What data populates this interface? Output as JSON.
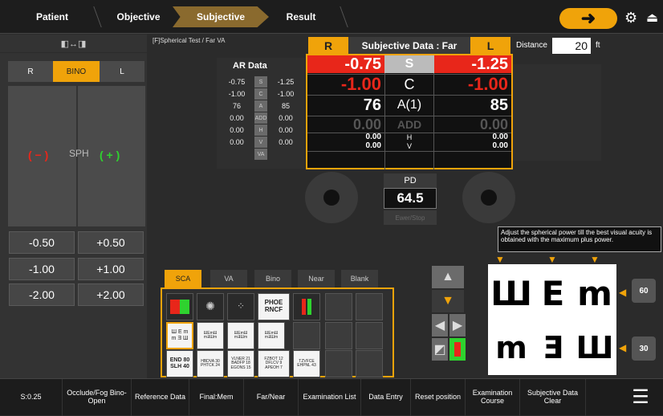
{
  "nav": {
    "steps": [
      "Patient",
      "Objective",
      "Subjective",
      "Result"
    ],
    "active_step": "Subjective"
  },
  "header": {
    "test_name": "[F]Spherical Test / Far VA",
    "r_label": "R",
    "title": "Subjective Data : Far",
    "l_label": "L",
    "distance_label": "Distance",
    "distance_value": "20",
    "distance_unit": "ft"
  },
  "left_panel": {
    "eye_buttons": [
      "R",
      "BINO",
      "L"
    ],
    "active_eye": "BINO",
    "minus_label": "( − )",
    "sph_label": "SPH",
    "plus_label": "( + )",
    "step_buttons": [
      "-0.50",
      "+0.50",
      "-1.00",
      "+1.00",
      "-2.00",
      "+2.00"
    ]
  },
  "ar_data": {
    "title": "AR Data",
    "rows": [
      {
        "r": "-0.75",
        "tag": "S",
        "l": "-1.25"
      },
      {
        "r": "-1.00",
        "tag": "C",
        "l": "-1.00"
      },
      {
        "r": "76",
        "tag": "A",
        "l": "85"
      },
      {
        "r": "0.00",
        "tag": "ADD",
        "l": "0.00"
      },
      {
        "r": "0.00",
        "tag": "H",
        "l": "0.00"
      },
      {
        "r": "0.00",
        "tag": "V",
        "l": "0.00"
      },
      {
        "r": "",
        "tag": "VA",
        "l": ""
      }
    ],
    "right_tags": [
      "S",
      "C",
      "A",
      "ADD",
      "H",
      "V",
      "VA"
    ]
  },
  "subjective": {
    "s_r": "-0.75",
    "s_label": "S",
    "s_l": "-1.25",
    "c_r": "-1.00",
    "c_label": "C",
    "c_l": "-1.00",
    "a_r": "76",
    "a_label": "A(1)",
    "a_l": "85",
    "add_r": "0.00",
    "add_label": "ADD",
    "add_l": "0.00",
    "h_r": "0.00",
    "h_label": "H",
    "h_l": "0.00",
    "v_r": "0.00",
    "v_label": "V",
    "v_l": "0.00"
  },
  "pd": {
    "label": "PD",
    "value": "64.5",
    "small_button": "Ewer/Stop"
  },
  "chart_tabs": [
    "SCA",
    "VA",
    "Bino",
    "Near",
    "Blank"
  ],
  "active_tab": "SCA",
  "tiles": {
    "phoe": "PHOE RNCF",
    "end": "END 80 SLH 40",
    "hbd": "HBDVA 30 PHTCK 24",
    "vln": "VLNER 21 BADFP 18 EGONS 15",
    "fzb": "FZBOT 12 DFLCV 9 APEOH 7",
    "tzv": "TZVFCE EHPNL 43"
  },
  "instruction": "Adjust the spherical power till the best visual acuity is obtained with the maximum plus power.",
  "chart_display": {
    "letters_top": [
      "Ш",
      "E",
      "m"
    ],
    "letters_bottom": [
      "m",
      "Ǝ",
      "Ш"
    ],
    "size_top": "60",
    "size_bottom": "30"
  },
  "bottom_bar": {
    "s_value": "S:0.25",
    "items": [
      "Occlude/Fog Bino-Open",
      "Reference Data",
      "Final:Mem",
      "Far/Near",
      "Examination List",
      "Data Entry",
      "Reset position",
      "Examination Course",
      "Subjective Data Clear"
    ]
  },
  "colors": {
    "accent": "#f0a30a",
    "red": "#e8261a",
    "green": "#2fd22f"
  }
}
